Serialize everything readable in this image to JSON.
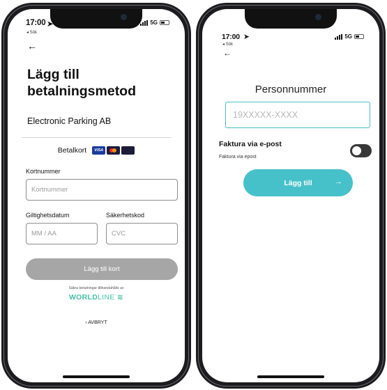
{
  "status_left": {
    "time": "17:00",
    "back_app": "◂ Sök",
    "network": "5G"
  },
  "status_right": {
    "time": "17:00",
    "back_app": "◂ Sök",
    "network": "5G"
  },
  "payment": {
    "title": "Lägg till betalningsmetod",
    "merchant": "Electronic Parking AB",
    "card_label": "Betalkort",
    "card_logos": [
      "visa",
      "mastercard",
      "maestro"
    ],
    "card_number_label": "Kortnummer",
    "card_number_placeholder": "Kortnummer",
    "expiry_label": "Giltighetsdatum",
    "expiry_placeholder": "MM / AA",
    "cvc_label": "Säkerhetskod",
    "cvc_placeholder": "CVC",
    "add_card_button": "Lägg till kort",
    "secure_note": "Säkra betalningar tillhandahålls av",
    "provider_strong": "WORLD",
    "provider_light": "LINE",
    "cancel": "AVBRYT"
  },
  "invoice": {
    "title": "Personnummer",
    "personnummer_placeholder": "19XXXXX-XXXX",
    "toggle_label": "Faktura via e-post",
    "toggle_sub": "Faktura via epost",
    "toggle_on": false,
    "submit_button": "Lägg till"
  },
  "colors": {
    "accent": "#47c1c9",
    "worldline": "#46beaa",
    "disabled_button": "#a6a6a6"
  }
}
